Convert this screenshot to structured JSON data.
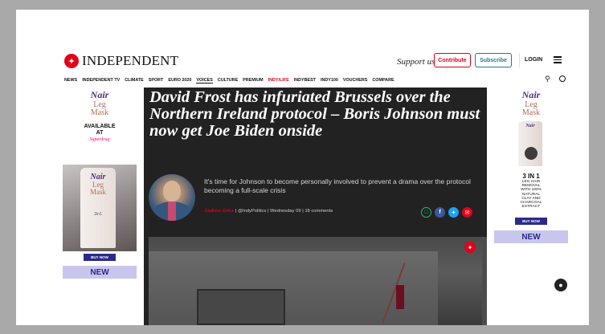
{
  "header": {
    "logo_text": "INDEPENDENT",
    "support_text": "Support us",
    "contribute_label": "Contribute",
    "subscribe_label": "Subscribe",
    "login_label": "LOGIN"
  },
  "nav": {
    "items": [
      "NEWS",
      "INDEPENDENT TV",
      "CLIMATE",
      "SPORT",
      "EURO 2020",
      "VOICES",
      "CULTURE",
      "PREMIUM",
      "INDY/LIFE",
      "INDYBEST",
      "INDY100",
      "VOUCHERS",
      "COMPARE"
    ],
    "active": "VOICES"
  },
  "ad_left": {
    "brand": "Nair",
    "product_line1": "Leg",
    "product_line2": "Mask",
    "available": "AVAILABLE",
    "at": "AT",
    "retailer": "Superdrug",
    "tube_brand": "Nair",
    "tube_line1": "Leg",
    "tube_line2": "Mask",
    "tube_small": "2in1",
    "buy_now": "BUY NOW",
    "new_label": "NEW"
  },
  "ad_right": {
    "brand": "Nair",
    "product_line1": "Leg",
    "product_line2": "Mask",
    "tube_brand": "Nair",
    "headline": "3 IN 1",
    "sub1": "LEG HAIR",
    "sub2": "REMOVAL",
    "sub3": "WITH 100%",
    "sub4": "NATURAL",
    "sub5": "CLAY AND",
    "sub6": "CHARCOAL",
    "sub7": "EXTRACT",
    "buy_now": "BUY NOW",
    "new_label": "NEW"
  },
  "article": {
    "headline": "David Frost has infuriated Brussels over the Northern Ireland protocol – Boris Johnson must now get Joe Biden onside",
    "standfirst": "It's time for Johnson to become personally involved to prevent a drama over the protocol becoming a full-scale crisis",
    "author": "Andrew Grice",
    "byline_rest": " | @IndyPolitics | Wednesday 09 | 18 comments"
  },
  "colors": {
    "brand_red": "#e2001a",
    "subscribe_teal": "#1f7a8c",
    "article_bg": "#222222",
    "ad_purple": "#4b2e83",
    "ad_band": "#c9c6ee"
  },
  "icons": [
    "eagle-logo-icon",
    "menu-icon",
    "search-icon",
    "globe-icon",
    "bookmark-icon",
    "facebook-icon",
    "twitter-icon",
    "mail-icon",
    "notification-bell-icon",
    "independent-badge-icon"
  ]
}
